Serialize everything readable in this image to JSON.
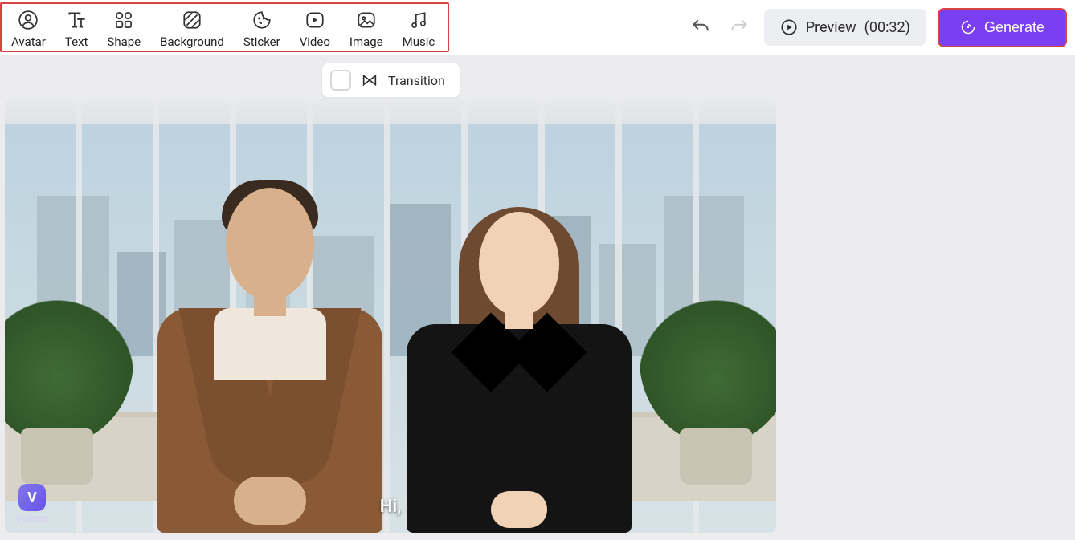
{
  "toolbar": {
    "items": [
      {
        "label": "Avatar",
        "icon": "avatar-icon"
      },
      {
        "label": "Text",
        "icon": "text-icon"
      },
      {
        "label": "Shape",
        "icon": "shape-icon"
      },
      {
        "label": "Background",
        "icon": "background-icon"
      },
      {
        "label": "Sticker",
        "icon": "sticker-icon"
      },
      {
        "label": "Video",
        "icon": "video-icon"
      },
      {
        "label": "Image",
        "icon": "image-icon"
      },
      {
        "label": "Music",
        "icon": "music-icon"
      }
    ]
  },
  "actions": {
    "undo": "Undo",
    "redo": "Redo",
    "preview_label": "Preview",
    "preview_time": "(00:32)",
    "generate_label": "Generate"
  },
  "transition": {
    "label": "Transition",
    "checked": false
  },
  "canvas": {
    "subtitle": "Hi,",
    "watermark": "Vidnoz"
  }
}
